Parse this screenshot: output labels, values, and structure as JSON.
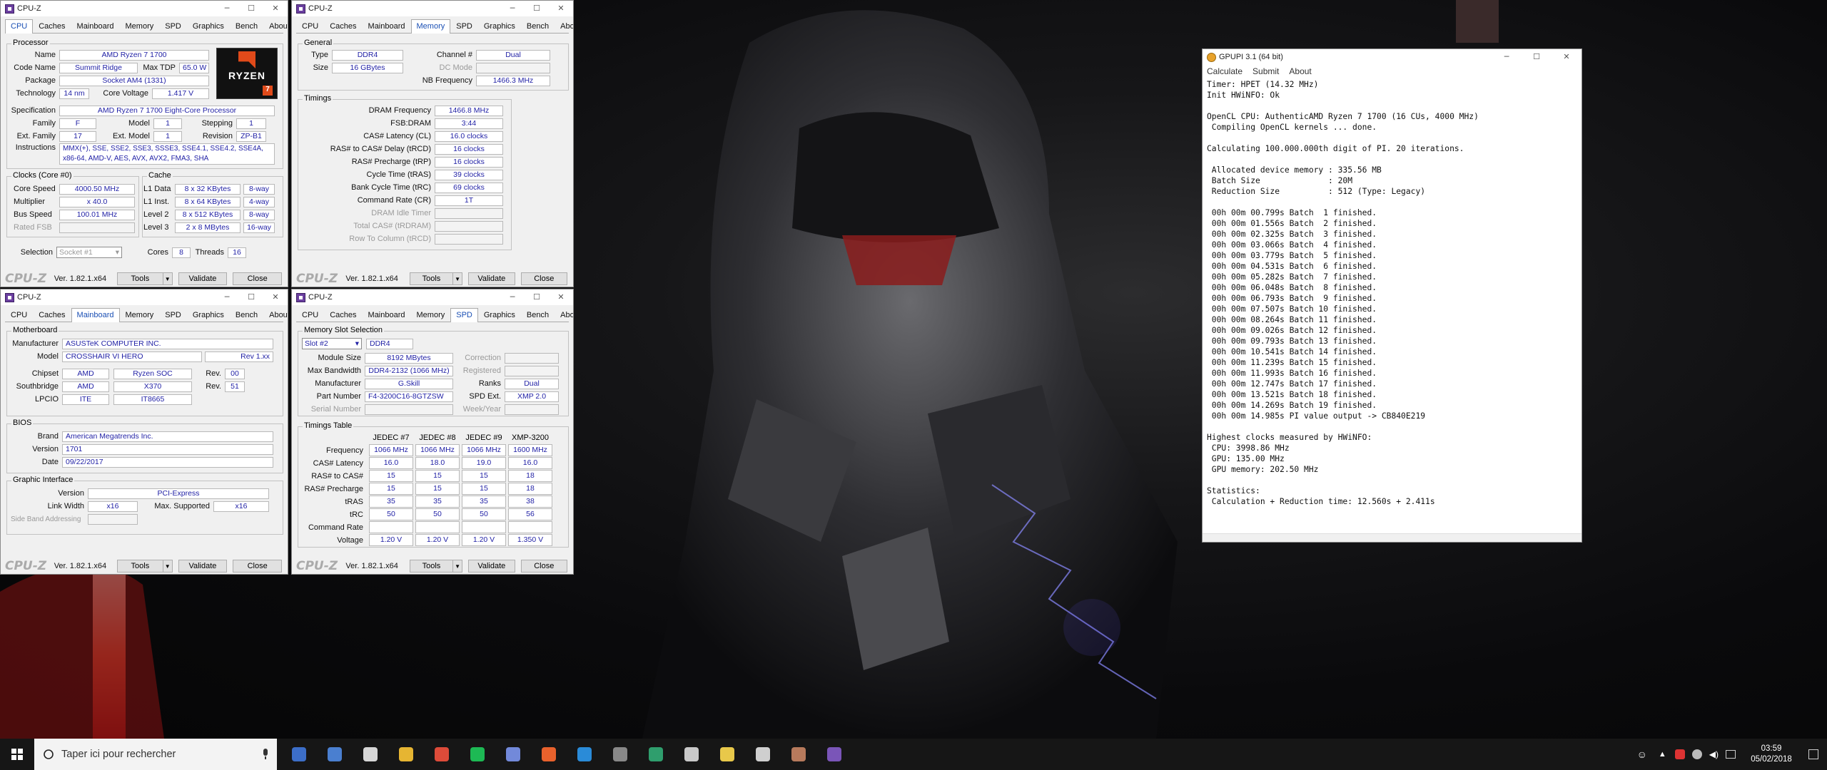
{
  "cpuz_cpu": {
    "title": "CPU-Z",
    "tabs": [
      "CPU",
      "Caches",
      "Mainboard",
      "Memory",
      "SPD",
      "Graphics",
      "Bench",
      "About"
    ],
    "active": "CPU",
    "processor_label": "Processor",
    "name": "AMD Ryzen 7 1700",
    "code_name": "Summit Ridge",
    "max_tdp": "65.0 W",
    "package": "Socket AM4 (1331)",
    "technology": "14 nm",
    "core_voltage": "1.417 V",
    "specification": "AMD Ryzen 7 1700 Eight-Core Processor",
    "family": "F",
    "model": "1",
    "stepping": "1",
    "ext_family": "17",
    "ext_model": "1",
    "revision": "ZP-B1",
    "instructions": "MMX(+), SSE, SSE2, SSE3, SSSE3, SSE4.1, SSE4.2, SSE4A, x86-64, AMD-V, AES, AVX, AVX2, FMA3, SHA",
    "clocks_label": "Clocks (Core #0)",
    "core_speed": "4000.50 MHz",
    "multiplier": "x 40.0",
    "bus_speed": "100.01 MHz",
    "rated_fsb": "",
    "cache_label": "Cache",
    "l1d": "8 x 32 KBytes",
    "l1d_way": "8-way",
    "l1i": "8 x 64 KBytes",
    "l1i_way": "4-way",
    "l2": "8 x 512 KBytes",
    "l2_way": "8-way",
    "l3": "2 x 8 MBytes",
    "l3_way": "16-way",
    "selection": "Socket #1",
    "cores": "8",
    "threads": "16",
    "logo_text": "RYZEN",
    "logo_num": "7"
  },
  "labels": {
    "name": "Name",
    "code_name": "Code Name",
    "max_tdp": "Max TDP",
    "package": "Package",
    "technology": "Technology",
    "core_voltage": "Core Voltage",
    "specification": "Specification",
    "family": "Family",
    "model": "Model",
    "stepping": "Stepping",
    "ext_family": "Ext. Family",
    "ext_model": "Ext. Model",
    "revision": "Revision",
    "instructions": "Instructions",
    "core_speed": "Core Speed",
    "multiplier": "Multiplier",
    "bus_speed": "Bus Speed",
    "rated_fsb": "Rated FSB",
    "l1d": "L1 Data",
    "l1i": "L1 Inst.",
    "l2": "Level 2",
    "l3": "Level 3",
    "selection": "Selection",
    "cores": "Cores",
    "threads": "Threads"
  },
  "cpuz_footer": {
    "logo": "CPU-Z",
    "version": "Ver. 1.82.1.x64",
    "tools": "Tools",
    "validate": "Validate",
    "close": "Close"
  },
  "cpuz_mem": {
    "title": "CPU-Z",
    "active": "Memory",
    "general": "General",
    "type_l": "Type",
    "type": "DDR4",
    "channel_l": "Channel #",
    "channel": "Dual",
    "size_l": "Size",
    "size": "16 GBytes",
    "dcmode_l": "DC Mode",
    "nbfreq_l": "NB Frequency",
    "nbfreq": "1466.3 MHz",
    "timings": "Timings",
    "t": [
      [
        "DRAM Frequency",
        "1466.8 MHz"
      ],
      [
        "FSB:DRAM",
        "3:44"
      ],
      [
        "CAS# Latency (CL)",
        "16.0 clocks"
      ],
      [
        "RAS# to CAS# Delay (tRCD)",
        "16 clocks"
      ],
      [
        "RAS# Precharge (tRP)",
        "16 clocks"
      ],
      [
        "Cycle Time (tRAS)",
        "39 clocks"
      ],
      [
        "Bank Cycle Time (tRC)",
        "69 clocks"
      ],
      [
        "Command Rate (CR)",
        "1T"
      ],
      [
        "DRAM Idle Timer",
        ""
      ],
      [
        "Total CAS# (tRDRAM)",
        ""
      ],
      [
        "Row To Column (tRCD)",
        ""
      ]
    ]
  },
  "cpuz_mb": {
    "title": "CPU-Z",
    "active": "Mainboard",
    "motherboard": "Motherboard",
    "manufacturer_l": "Manufacturer",
    "manufacturer": "ASUSTeK COMPUTER INC.",
    "model_l": "Model",
    "model": "CROSSHAIR VI HERO",
    "model_rev": "Rev 1.xx",
    "chipset_l": "Chipset",
    "chipset": "AMD",
    "chipset2": "Ryzen SOC",
    "rev_l": "Rev.",
    "chipset_rev": "00",
    "south_l": "Southbridge",
    "south": "AMD",
    "south2": "X370",
    "south_rev": "51",
    "lpcio_l": "LPCIO",
    "lpcio": "ITE",
    "lpcio2": "IT8665",
    "bios": "BIOS",
    "brand_l": "Brand",
    "brand": "American Megatrends Inc.",
    "version_l": "Version",
    "version": "1701",
    "date_l": "Date",
    "date": "09/22/2017",
    "gi": "Graphic Interface",
    "giver_l": "Version",
    "giver": "PCI-Express",
    "lw_l": "Link Width",
    "lw": "x16",
    "ms_l": "Max. Supported",
    "ms": "x16",
    "sba_l": "Side Band Addressing"
  },
  "cpuz_spd": {
    "title": "CPU-Z",
    "active": "SPD",
    "slotsel": "Memory Slot Selection",
    "slot": "Slot #2",
    "ddr": "DDR4",
    "modsize_l": "Module Size",
    "modsize": "8192 MBytes",
    "correction_l": "Correction",
    "maxbw_l": "Max Bandwidth",
    "maxbw": "DDR4-2132 (1066 MHz)",
    "registered_l": "Registered",
    "manuf_l": "Manufacturer",
    "manuf": "G.Skill",
    "ranks_l": "Ranks",
    "ranks": "Dual",
    "part_l": "Part Number",
    "part": "F4-3200C16-8GTZSW",
    "spdext_l": "SPD Ext.",
    "spdext": "XMP 2.0",
    "serial_l": "Serial Number",
    "week_l": "Week/Year",
    "ttable": "Timings Table",
    "cols": [
      "JEDEC #7",
      "JEDEC #8",
      "JEDEC #9",
      "XMP-3200"
    ],
    "rows": [
      [
        "Frequency",
        "1066 MHz",
        "1066 MHz",
        "1066 MHz",
        "1600 MHz"
      ],
      [
        "CAS# Latency",
        "16.0",
        "18.0",
        "19.0",
        "16.0"
      ],
      [
        "RAS# to CAS#",
        "15",
        "15",
        "15",
        "18"
      ],
      [
        "RAS# Precharge",
        "15",
        "15",
        "15",
        "18"
      ],
      [
        "tRAS",
        "35",
        "35",
        "35",
        "38"
      ],
      [
        "tRC",
        "50",
        "50",
        "50",
        "56"
      ],
      [
        "Command Rate",
        "",
        "",
        "",
        ""
      ],
      [
        "Voltage",
        "1.20 V",
        "1.20 V",
        "1.20 V",
        "1.350 V"
      ]
    ]
  },
  "gpupi": {
    "title": "GPUPI 3.1 (64 bit)",
    "menu": [
      "Calculate",
      "Submit",
      "About"
    ],
    "log": [
      "Timer: HPET (14.32 MHz)",
      "Init HWiNFO: Ok",
      "",
      "OpenCL CPU: AuthenticAMD Ryzen 7 1700 (16 CUs, 4000 MHz)",
      " Compiling OpenCL kernels ... done.",
      "",
      "Calculating 100.000.000th digit of PI. 20 iterations.",
      "",
      " Allocated device memory : 335.56 MB",
      " Batch Size              : 20M",
      " Reduction Size          : 512 (Type: Legacy)",
      "",
      " 00h 00m 00.799s Batch  1 finished.",
      " 00h 00m 01.556s Batch  2 finished.",
      " 00h 00m 02.325s Batch  3 finished.",
      " 00h 00m 03.066s Batch  4 finished.",
      " 00h 00m 03.779s Batch  5 finished.",
      " 00h 00m 04.531s Batch  6 finished.",
      " 00h 00m 05.282s Batch  7 finished.",
      " 00h 00m 06.048s Batch  8 finished.",
      " 00h 00m 06.793s Batch  9 finished.",
      " 00h 00m 07.507s Batch 10 finished.",
      " 00h 00m 08.264s Batch 11 finished.",
      " 00h 00m 09.026s Batch 12 finished.",
      " 00h 00m 09.793s Batch 13 finished.",
      " 00h 00m 10.541s Batch 14 finished.",
      " 00h 00m 11.239s Batch 15 finished.",
      " 00h 00m 11.993s Batch 16 finished.",
      " 00h 00m 12.747s Batch 17 finished.",
      " 00h 00m 13.521s Batch 18 finished.",
      " 00h 00m 14.269s Batch 19 finished.",
      " 00h 00m 14.985s PI value output -> CB840E219",
      "",
      "Highest clocks measured by HWiNFO:",
      " CPU: 3998.86 MHz",
      " GPU: 135.00 MHz",
      " GPU memory: 202.50 MHz",
      "",
      "Statistics:",
      " Calculation + Reduction time: 12.560s + 2.411s"
    ]
  },
  "taskbar": {
    "search": "Taper ici pour rechercher",
    "time": "03:59",
    "date": "05/02/2018",
    "apps": [
      "#3c6ec8",
      "#4a7fd0",
      "#d6d6d6",
      "#e6b532",
      "#dd4b39",
      "#1db954",
      "#7289da",
      "#e8612c",
      "#2a8bd8",
      "#888888",
      "#2f9e6d",
      "#c9c9c9",
      "#e8c84a",
      "#cfcfcf",
      "#b77a5c",
      "#7a55b8"
    ]
  }
}
